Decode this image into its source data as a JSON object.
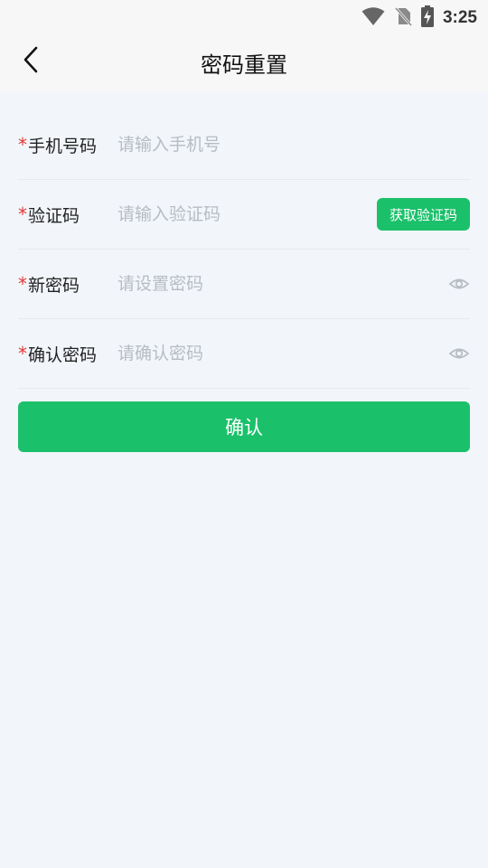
{
  "status_bar": {
    "time": "3:25",
    "icons": [
      "wifi-icon",
      "no-sim-icon",
      "battery-charging-icon"
    ]
  },
  "header": {
    "title": "密码重置",
    "back_icon": "chevron-left-icon"
  },
  "form": {
    "phone": {
      "required_mark": "*",
      "label": "手机号码",
      "placeholder": "请输入手机号",
      "value": ""
    },
    "code": {
      "required_mark": "*",
      "label": "验证码",
      "placeholder": "请输入验证码",
      "value": "",
      "button_label": "获取验证码"
    },
    "new_password": {
      "required_mark": "*",
      "label": "新密码",
      "placeholder": "请设置密码",
      "value": "",
      "icon": "eye-icon"
    },
    "confirm_password": {
      "required_mark": "*",
      "label": "确认密码",
      "placeholder": "请确认密码",
      "value": "",
      "icon": "eye-icon"
    }
  },
  "confirm_button": {
    "label": "确认"
  },
  "colors": {
    "accent": "#1bc06a",
    "required": "#e53935",
    "background": "#f2f5fa",
    "placeholder": "#b7bcc4"
  }
}
